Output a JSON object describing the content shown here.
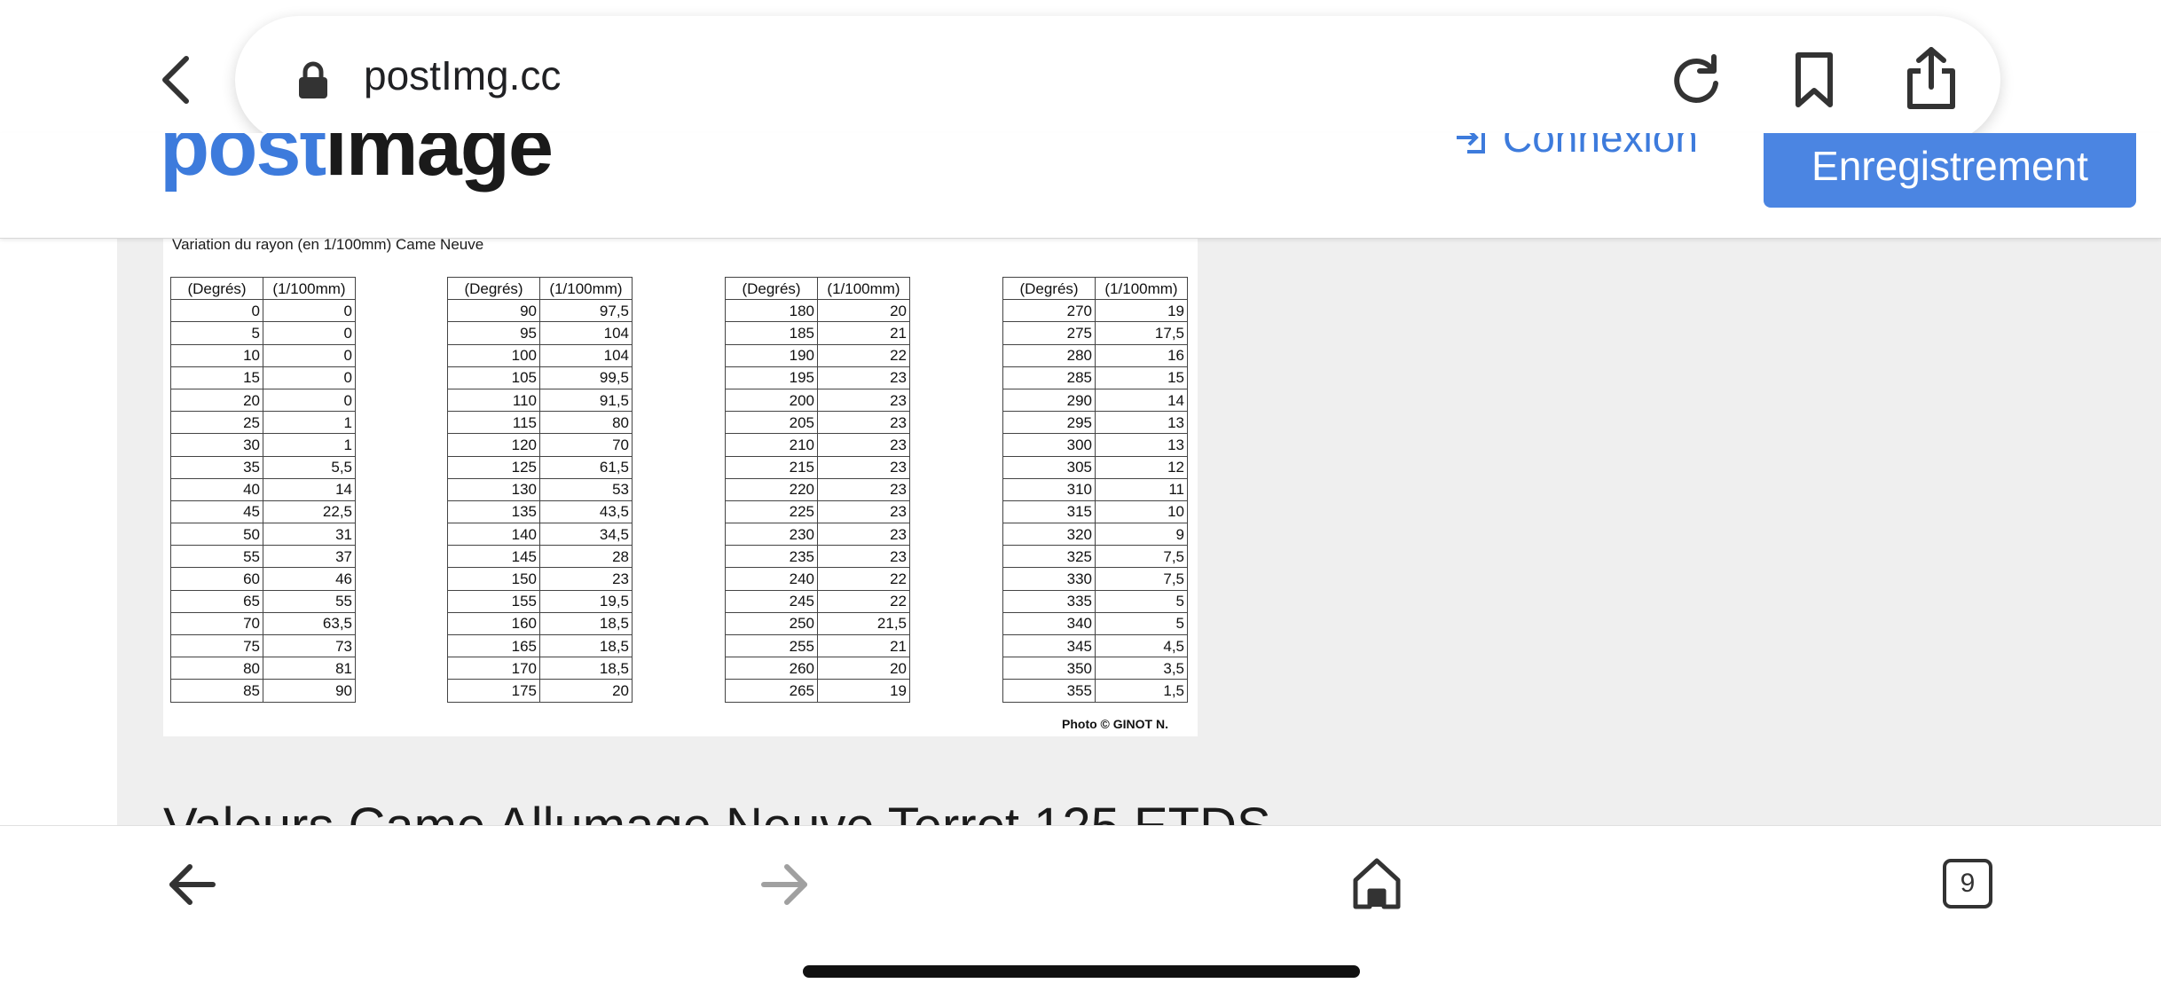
{
  "browser": {
    "url": "postImg.cc"
  },
  "site_header": {
    "logo_post": "post",
    "logo_image": "image",
    "login_label": "Connexion",
    "register_label": "Enregistrement"
  },
  "photo": {
    "caption": "Variation du rayon (en 1/100mm) Came Neuve",
    "credit": "Photo © GINOT N.",
    "headers": [
      "(Degrés)",
      "(1/100mm)"
    ],
    "tables": [
      [
        [
          "0",
          "0"
        ],
        [
          "5",
          "0"
        ],
        [
          "10",
          "0"
        ],
        [
          "15",
          "0"
        ],
        [
          "20",
          "0"
        ],
        [
          "25",
          "1"
        ],
        [
          "30",
          "1"
        ],
        [
          "35",
          "5,5"
        ],
        [
          "40",
          "14"
        ],
        [
          "45",
          "22,5"
        ],
        [
          "50",
          "31"
        ],
        [
          "55",
          "37"
        ],
        [
          "60",
          "46"
        ],
        [
          "65",
          "55"
        ],
        [
          "70",
          "63,5"
        ],
        [
          "75",
          "73"
        ],
        [
          "80",
          "81"
        ],
        [
          "85",
          "90"
        ]
      ],
      [
        [
          "90",
          "97,5"
        ],
        [
          "95",
          "104"
        ],
        [
          "100",
          "104"
        ],
        [
          "105",
          "99,5"
        ],
        [
          "110",
          "91,5"
        ],
        [
          "115",
          "80"
        ],
        [
          "120",
          "70"
        ],
        [
          "125",
          "61,5"
        ],
        [
          "130",
          "53"
        ],
        [
          "135",
          "43,5"
        ],
        [
          "140",
          "34,5"
        ],
        [
          "145",
          "28"
        ],
        [
          "150",
          "23"
        ],
        [
          "155",
          "19,5"
        ],
        [
          "160",
          "18,5"
        ],
        [
          "165",
          "18,5"
        ],
        [
          "170",
          "18,5"
        ],
        [
          "175",
          "20"
        ]
      ],
      [
        [
          "180",
          "20"
        ],
        [
          "185",
          "21"
        ],
        [
          "190",
          "22"
        ],
        [
          "195",
          "23"
        ],
        [
          "200",
          "23"
        ],
        [
          "205",
          "23"
        ],
        [
          "210",
          "23"
        ],
        [
          "215",
          "23"
        ],
        [
          "220",
          "23"
        ],
        [
          "225",
          "23"
        ],
        [
          "230",
          "23"
        ],
        [
          "235",
          "23"
        ],
        [
          "240",
          "22"
        ],
        [
          "245",
          "22"
        ],
        [
          "250",
          "21,5"
        ],
        [
          "255",
          "21"
        ],
        [
          "260",
          "20"
        ],
        [
          "265",
          "19"
        ]
      ],
      [
        [
          "270",
          "19"
        ],
        [
          "275",
          "17,5"
        ],
        [
          "280",
          "16"
        ],
        [
          "285",
          "15"
        ],
        [
          "290",
          "14"
        ],
        [
          "295",
          "13"
        ],
        [
          "300",
          "13"
        ],
        [
          "305",
          "12"
        ],
        [
          "310",
          "11"
        ],
        [
          "315",
          "10"
        ],
        [
          "320",
          "9"
        ],
        [
          "325",
          "7,5"
        ],
        [
          "330",
          "7,5"
        ],
        [
          "335",
          "5"
        ],
        [
          "340",
          "5"
        ],
        [
          "345",
          "4,5"
        ],
        [
          "350",
          "3,5"
        ],
        [
          "355",
          "1,5"
        ]
      ]
    ]
  },
  "page": {
    "title": "Valeurs Came Allumage Neuve Terrot 125 ETDS"
  },
  "bottom_toolbar": {
    "tab_count": "9"
  },
  "colors": {
    "brand_blue": "#3d7bdc",
    "button_blue": "#4b85e2",
    "page_background": "#efefef"
  }
}
